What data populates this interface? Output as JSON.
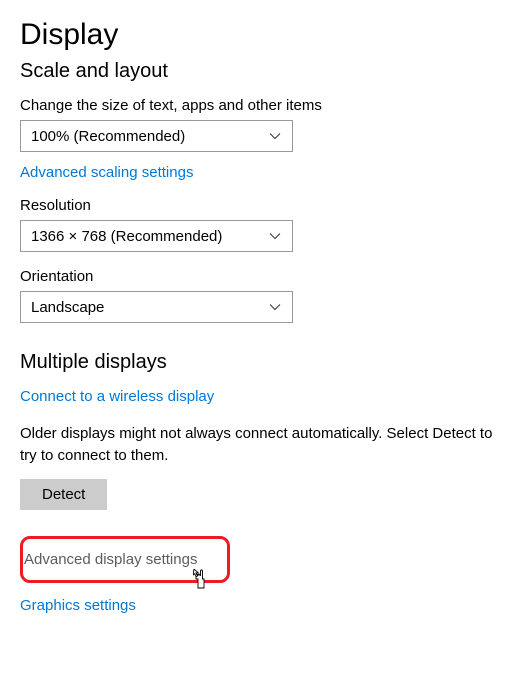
{
  "page": {
    "title": "Display"
  },
  "scale": {
    "header": "Scale and layout",
    "textSizeLabel": "Change the size of text, apps and other items",
    "textSizeValue": "100% (Recommended)",
    "advancedScalingLink": "Advanced scaling settings",
    "resolutionLabel": "Resolution",
    "resolutionValue": "1366 × 768 (Recommended)",
    "orientationLabel": "Orientation",
    "orientationValue": "Landscape"
  },
  "multiple": {
    "header": "Multiple displays",
    "wirelessLink": "Connect to a wireless display",
    "detectText": "Older displays might not always connect automatically. Select Detect to try to connect to them.",
    "detectButton": "Detect",
    "advancedDisplayLink": "Advanced display settings",
    "graphicsLink": "Graphics settings"
  }
}
